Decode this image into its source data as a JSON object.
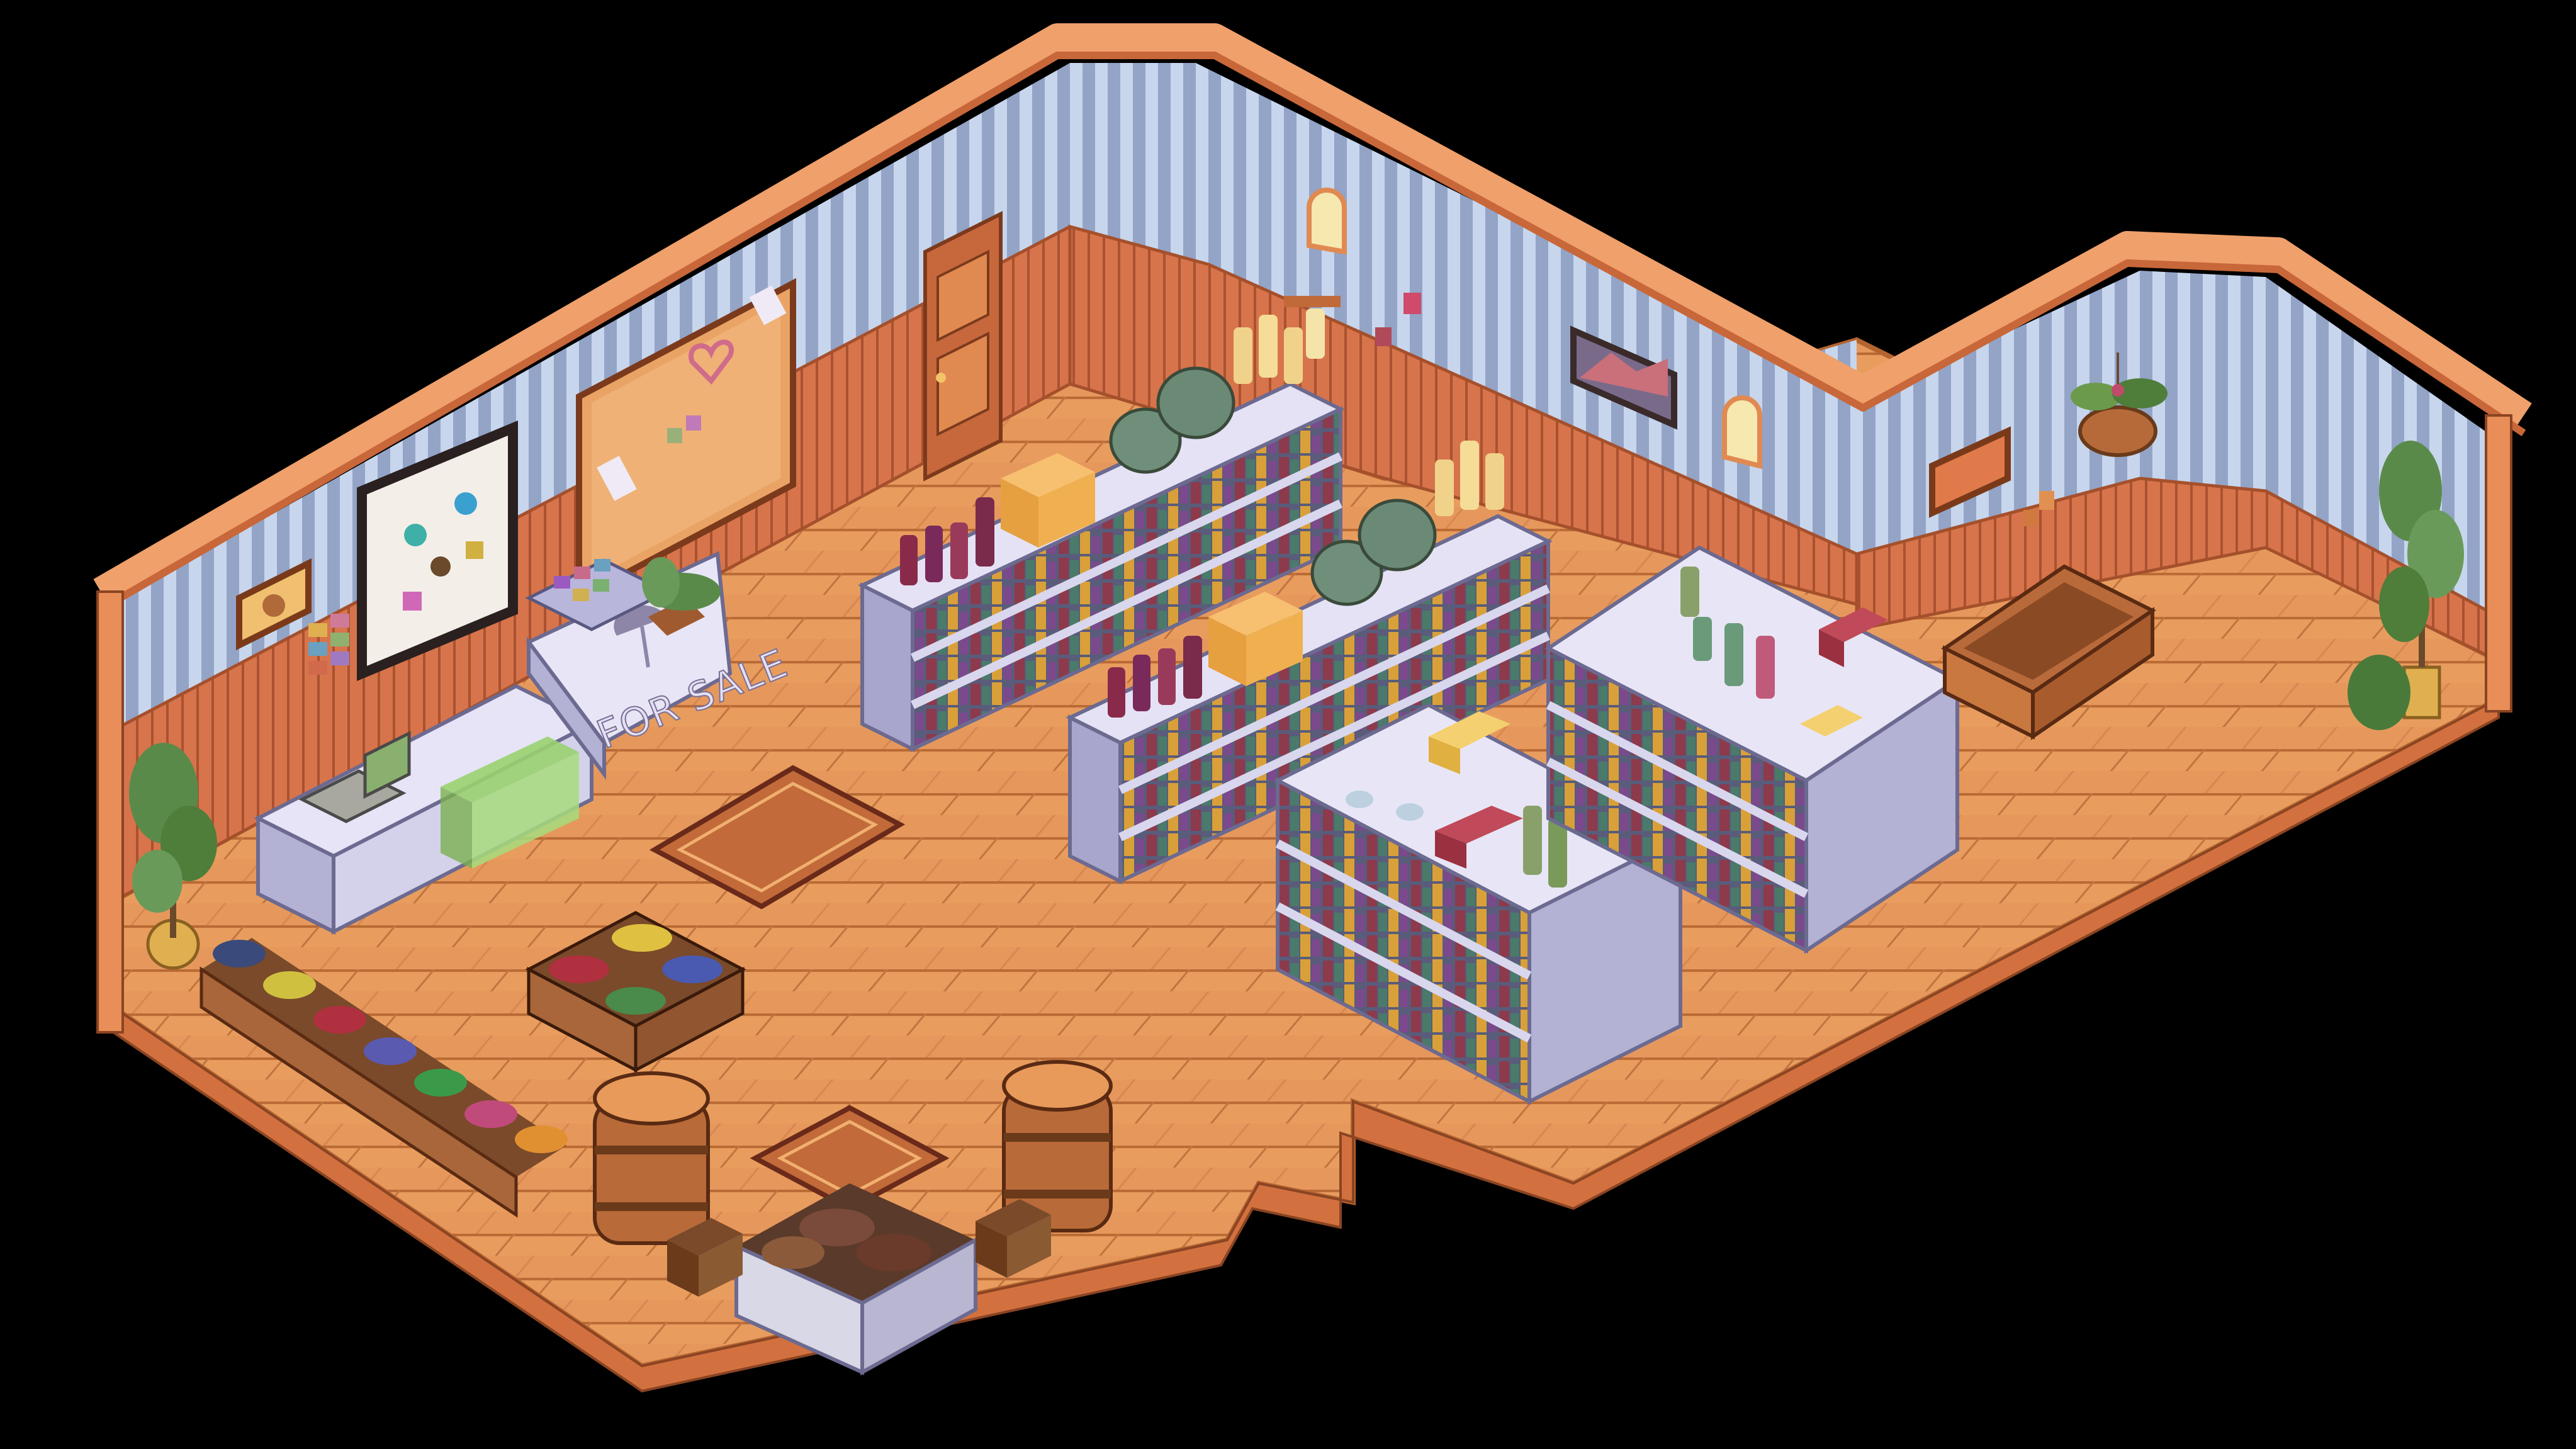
{
  "scene": {
    "counter_sign": "FOR SALE"
  },
  "colors": {
    "background": "#000000",
    "floor": "#e79a5a",
    "floor_dark": "#c9763f",
    "wall_stripe_blue": "#9fb0d0",
    "wall_stripe_light": "#c8d8ee",
    "wainscot": "#d9744a",
    "trim": "#f2a06a",
    "shelf": "#cfcde8",
    "shelf_shadow": "#8e8cb0"
  },
  "icons": {
    "counter_sign_symbol": "umbrella-icon",
    "notice_board_symbol": "heart-icon"
  }
}
